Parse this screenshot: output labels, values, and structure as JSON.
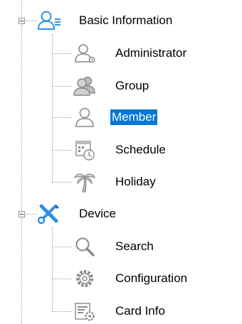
{
  "tree": {
    "basic_information": {
      "label": "Basic Information",
      "expanded": true,
      "icon": "users-list-icon",
      "children": [
        {
          "label": "Administrator",
          "icon": "admin-user-gear-icon"
        },
        {
          "label": "Group",
          "icon": "user-group-icon"
        },
        {
          "label": "Member",
          "icon": "user-icon",
          "selected": true
        },
        {
          "label": "Schedule",
          "icon": "calendar-clock-icon"
        },
        {
          "label": "Holiday",
          "icon": "palm-tree-icon"
        }
      ]
    },
    "device": {
      "label": "Device",
      "expanded": true,
      "icon": "wrench-screwdriver-icon",
      "children": [
        {
          "label": "Search",
          "icon": "magnifier-icon"
        },
        {
          "label": "Configuration",
          "icon": "gears-icon"
        },
        {
          "label": "Card Info",
          "icon": "card-gear-icon"
        }
      ]
    }
  },
  "colors": {
    "selection": "#0078d7",
    "accent_blue": "#2f8fe0",
    "icon_gray": "#8a8a8a"
  }
}
